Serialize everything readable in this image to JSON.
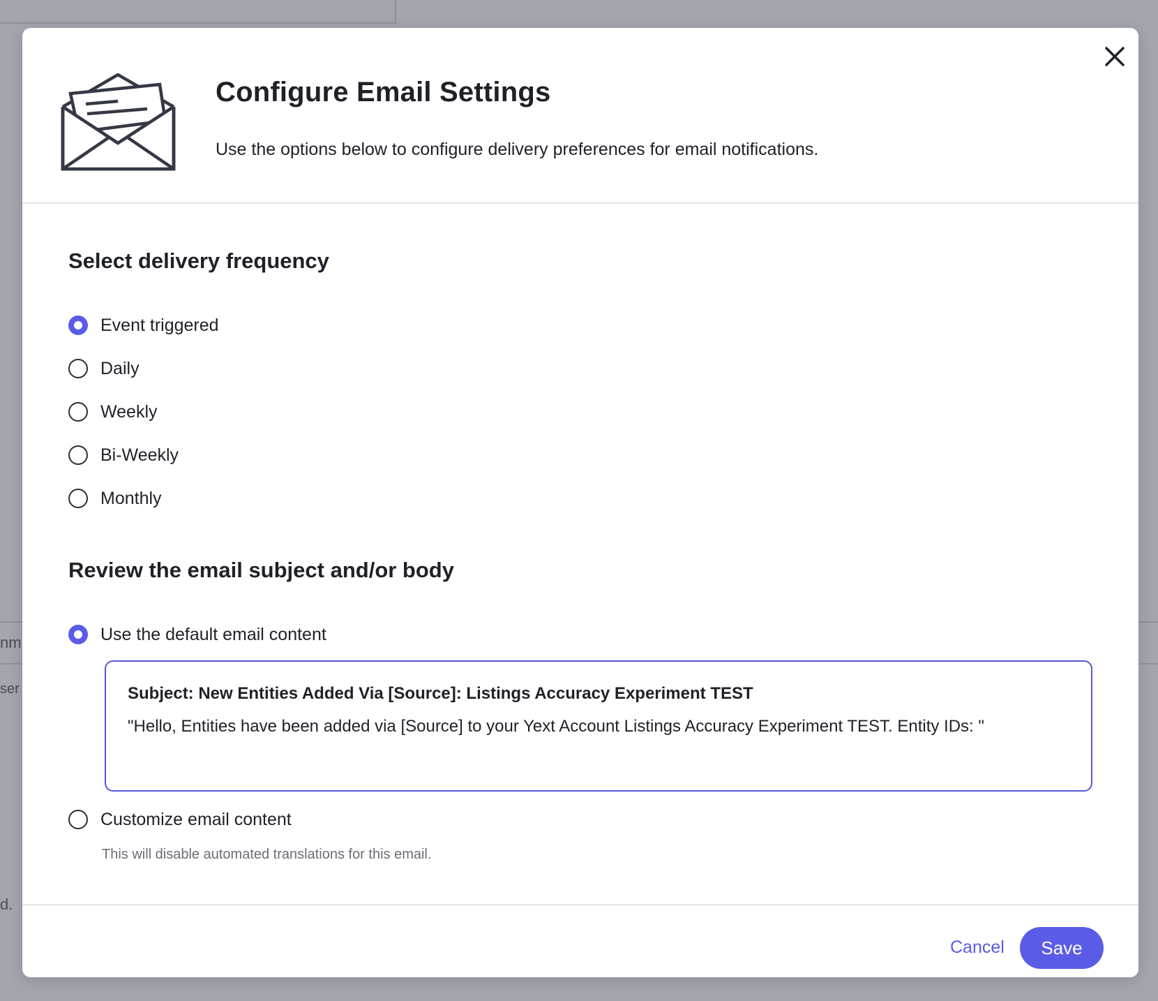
{
  "background": {
    "fragments": [
      "nm",
      "ser",
      "d."
    ]
  },
  "modal": {
    "title": "Configure Email Settings",
    "subtitle": "Use the options below to configure delivery preferences for email notifications.",
    "icon": "open-envelope-icon",
    "close_icon": "close-icon"
  },
  "frequency": {
    "heading": "Select delivery frequency",
    "options": [
      {
        "label": "Event triggered",
        "selected": true
      },
      {
        "label": "Daily",
        "selected": false
      },
      {
        "label": "Weekly",
        "selected": false
      },
      {
        "label": "Bi-Weekly",
        "selected": false
      },
      {
        "label": "Monthly",
        "selected": false
      }
    ]
  },
  "content": {
    "heading": "Review the email subject and/or body",
    "default_option": {
      "label": "Use the default email content",
      "selected": true
    },
    "preview": {
      "subject": "Subject: New Entities Added Via [Source]: Listings Accuracy Experiment TEST",
      "body": "\"Hello, Entities have been added via [Source] to your Yext Account Listings Accuracy Experiment TEST. Entity IDs: \""
    },
    "custom_option": {
      "label": "Customize email content",
      "selected": false
    },
    "custom_helper": "This will disable automated translations for this email."
  },
  "footer": {
    "cancel_label": "Cancel",
    "save_label": "Save"
  },
  "colors": {
    "accent": "#5a5be6",
    "backdrop": "#a4a6ae",
    "text": "#1f2128",
    "muted": "#6b6d76"
  }
}
